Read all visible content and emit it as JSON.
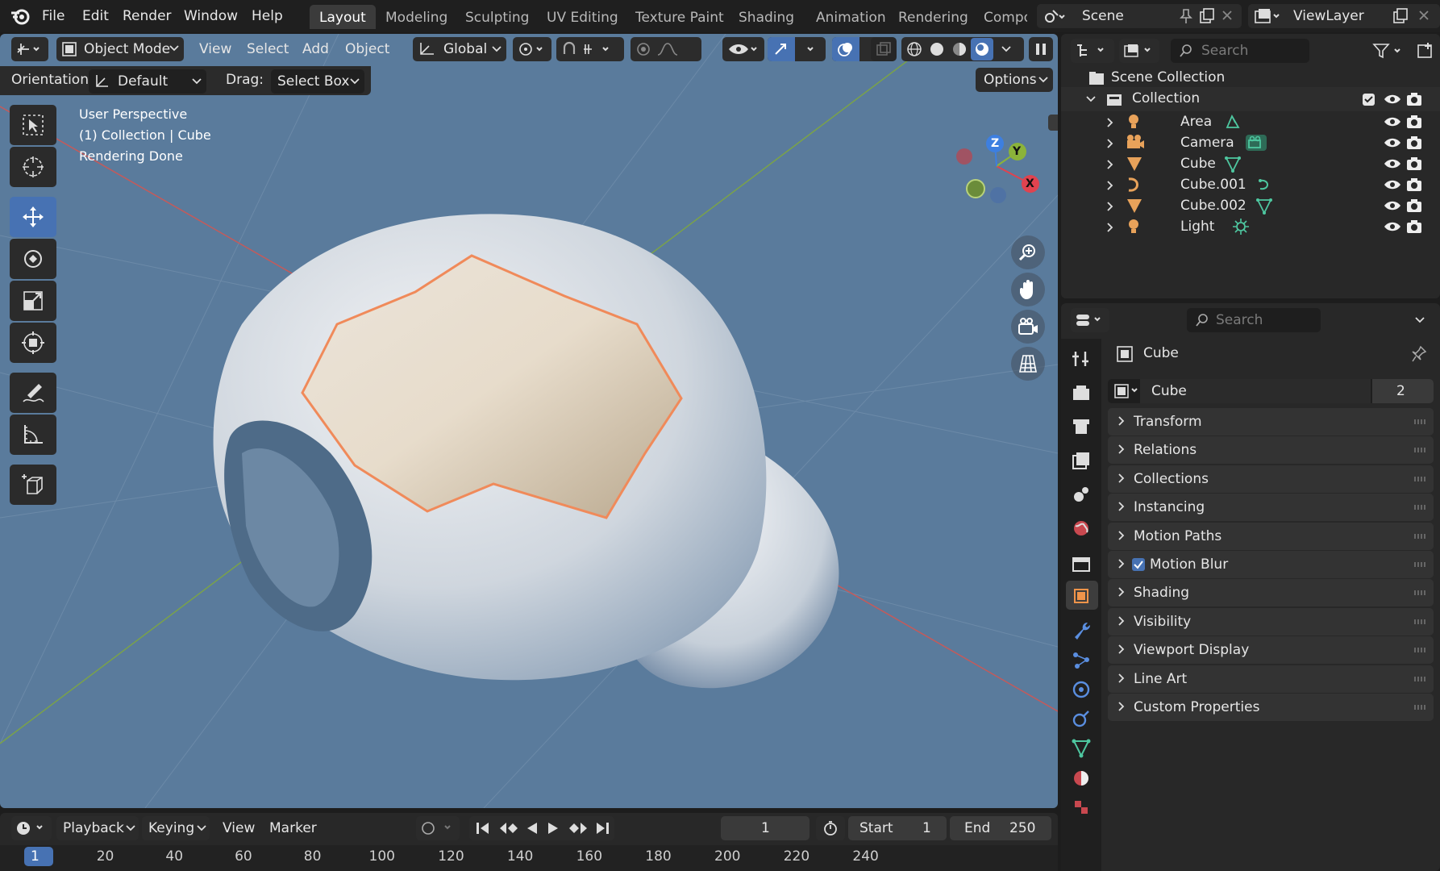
{
  "topbar": {
    "menus": [
      "File",
      "Edit",
      "Render",
      "Window",
      "Help"
    ],
    "workspaces": [
      "Layout",
      "Modeling",
      "Sculpting",
      "UV Editing",
      "Texture Paint",
      "Shading",
      "Animation",
      "Rendering",
      "Compo"
    ],
    "active_workspace": "Layout",
    "scene": "Scene",
    "view_layer": "ViewLayer"
  },
  "viewport_header": {
    "mode": "Object Mode",
    "menus": [
      "View",
      "Select",
      "Add",
      "Object"
    ],
    "transform_orientation": "Global"
  },
  "tool_settings": {
    "orientation_label": "Orientation:",
    "orientation_value": "Default",
    "drag_label": "Drag:",
    "drag_value": "Select Box",
    "options_label": "Options"
  },
  "viewport_overlay": {
    "line1": "User Perspective",
    "line2": "(1) Collection | Cube",
    "line3": "Rendering Done"
  },
  "gizmo_axes": {
    "x": "X",
    "y": "Y",
    "z": "Z",
    "x_color": "#e0434f",
    "y_color": "#8bb33a",
    "z_color": "#3d7fe0"
  },
  "outliner": {
    "search_placeholder": "Search",
    "scene_collection": "Scene Collection",
    "collection": "Collection",
    "items": [
      {
        "name": "Area",
        "type": "light"
      },
      {
        "name": "Camera",
        "type": "camera"
      },
      {
        "name": "Cube",
        "type": "mesh"
      },
      {
        "name": "Cube.001",
        "type": "curve"
      },
      {
        "name": "Cube.002",
        "type": "mesh"
      },
      {
        "name": "Light",
        "type": "light"
      }
    ]
  },
  "properties": {
    "search_placeholder": "Search",
    "object_name": "Cube",
    "datablock_name": "Cube",
    "users": "2",
    "panels": [
      "Transform",
      "Relations",
      "Collections",
      "Instancing",
      "Motion Paths",
      "Motion Blur",
      "Shading",
      "Visibility",
      "Viewport Display",
      "Line Art",
      "Custom Properties"
    ]
  },
  "timeline": {
    "menus": [
      "Playback",
      "Keying",
      "View",
      "Marker"
    ],
    "current_frame": "1",
    "start_label": "Start",
    "start_value": "1",
    "end_label": "End",
    "end_value": "250",
    "ruler": [
      "1",
      "20",
      "40",
      "60",
      "80",
      "100",
      "120",
      "140",
      "160",
      "180",
      "200",
      "220",
      "240"
    ]
  },
  "colors": {
    "accent": "#4772b3",
    "selection_outline": "#f08a5a",
    "viewport_bg": "#5a7b9c"
  }
}
